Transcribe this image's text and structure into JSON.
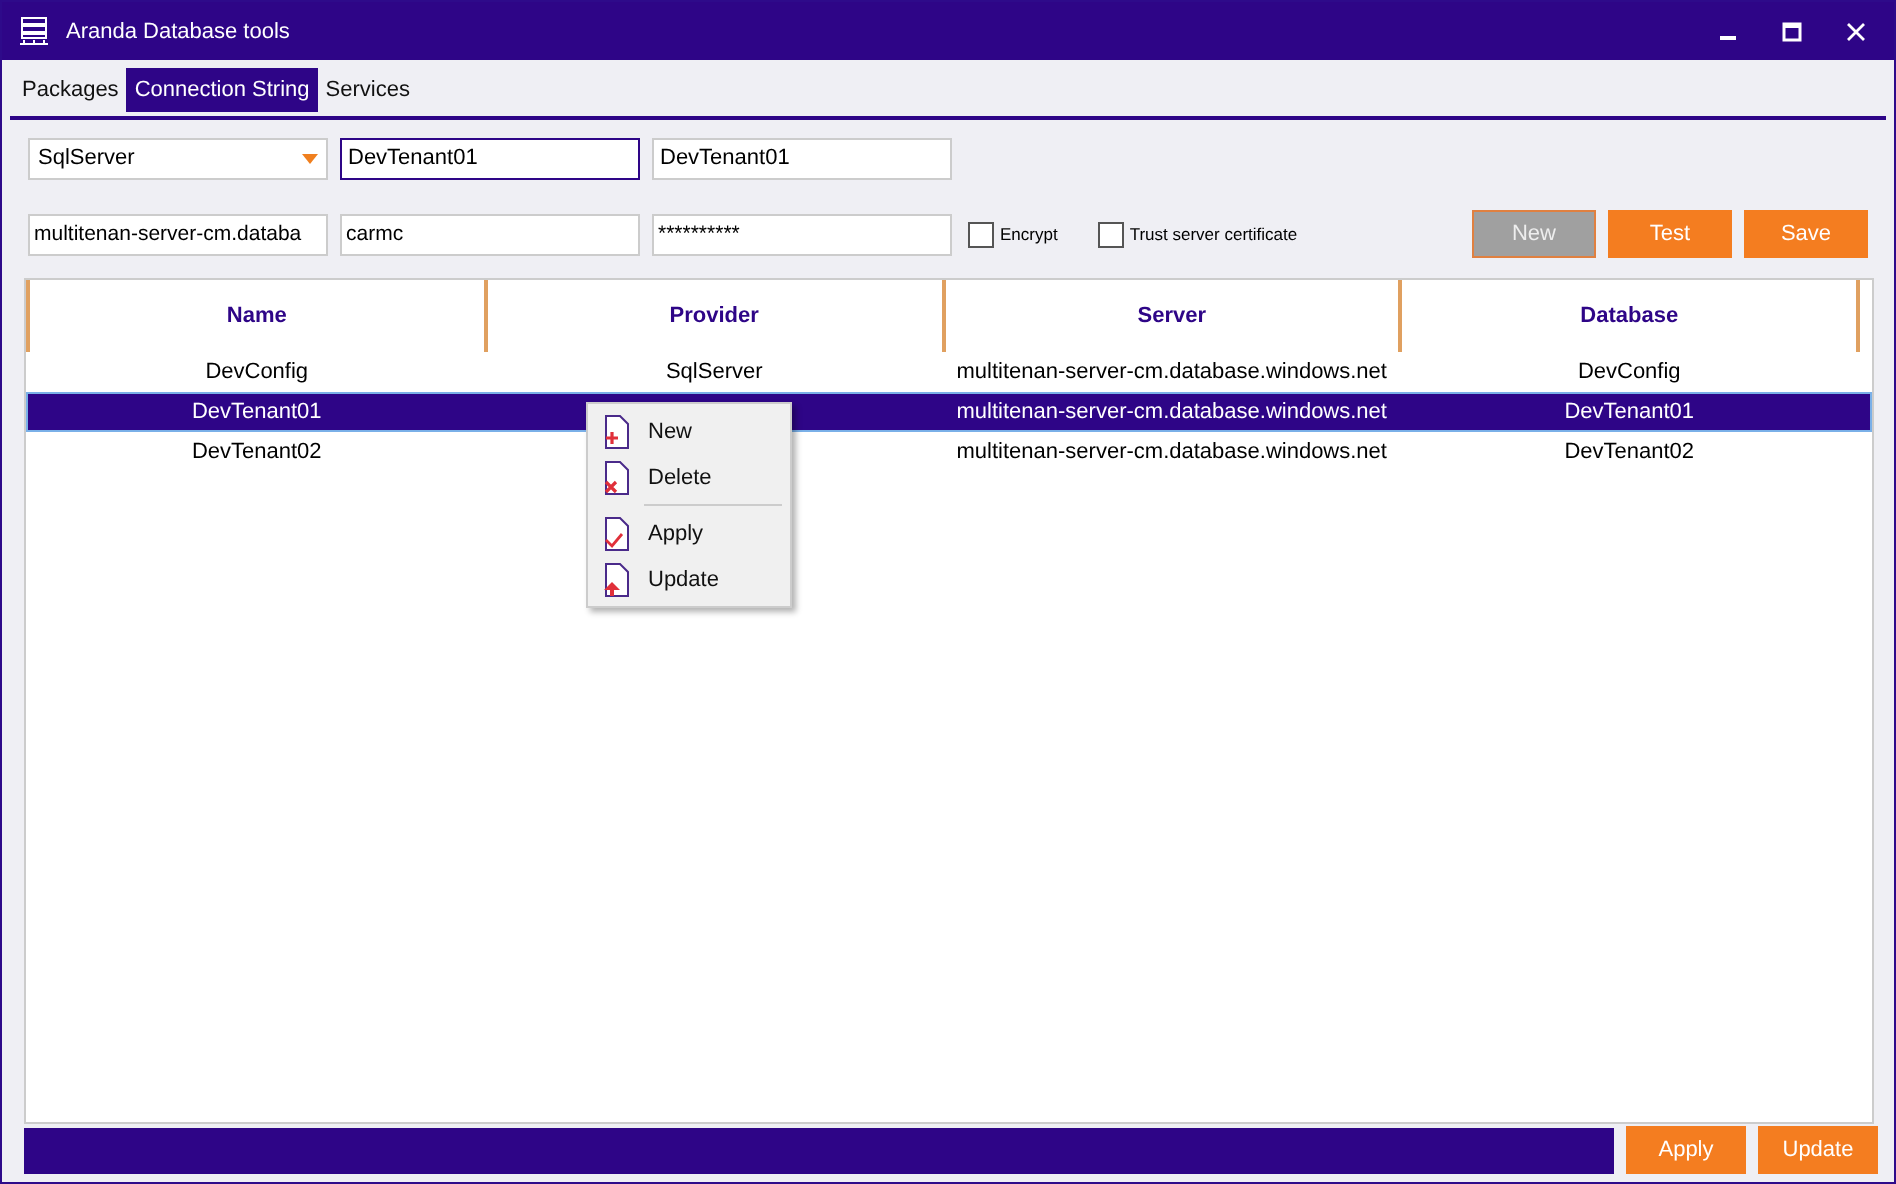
{
  "window": {
    "title": "Aranda Database tools"
  },
  "tabs": [
    {
      "label": "Packages",
      "selected": false
    },
    {
      "label": "Connection String",
      "selected": true
    },
    {
      "label": "Services",
      "selected": false
    }
  ],
  "provider_dropdown": {
    "value": "SqlServer"
  },
  "name_fields": [
    {
      "value": "DevTenant01",
      "focused": true
    },
    {
      "value": "DevTenant01",
      "focused": false
    }
  ],
  "connection_fields": [
    {
      "value": "multitenan-server-cm.databa"
    },
    {
      "value": "carmc"
    },
    {
      "value": "**********"
    }
  ],
  "checkboxes": [
    {
      "label": "Encrypt",
      "checked": false
    },
    {
      "label": "Trust server certificate",
      "checked": false
    }
  ],
  "top_buttons": [
    {
      "label": "New",
      "disabled": true
    },
    {
      "label": "Test",
      "disabled": false
    },
    {
      "label": "Save",
      "disabled": false
    }
  ],
  "table": {
    "columns": [
      "Name",
      "Provider",
      "Server",
      "Database"
    ],
    "rows": [
      {
        "cells": [
          "DevConfig",
          "SqlServer",
          "multitenan-server-cm.database.windows.net",
          "DevConfig"
        ],
        "selected": false
      },
      {
        "cells": [
          "DevTenant01",
          null,
          "multitenan-server-cm.database.windows.net",
          "DevTenant01"
        ],
        "selected": true
      },
      {
        "cells": [
          "DevTenant02",
          null,
          "multitenan-server-cm.database.windows.net",
          "DevTenant02"
        ],
        "selected": false
      }
    ]
  },
  "context_menu": {
    "groups": [
      [
        {
          "label": "New",
          "kind": "new"
        },
        {
          "label": "Delete",
          "kind": "delete"
        }
      ],
      [
        {
          "label": "Apply",
          "kind": "apply"
        },
        {
          "label": "Update",
          "kind": "update"
        }
      ]
    ]
  },
  "progress": {
    "level": 1
  },
  "bottom_buttons": [
    {
      "label": "Apply"
    },
    {
      "label": "Update"
    }
  ]
}
